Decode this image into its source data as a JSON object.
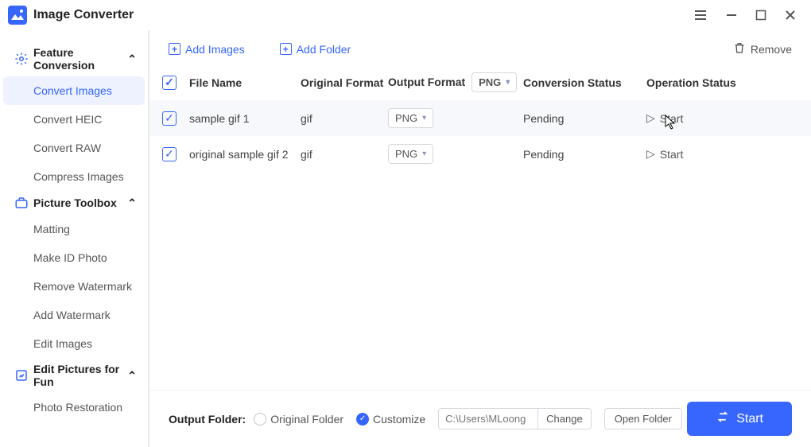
{
  "app": {
    "title": "Image Converter"
  },
  "sidebar": {
    "sections": [
      {
        "title": "Feature Conversion",
        "items": [
          "Convert Images",
          "Convert HEIC",
          "Convert RAW",
          "Compress Images"
        ],
        "active": 0
      },
      {
        "title": "Picture Toolbox",
        "items": [
          "Matting",
          "Make ID Photo",
          "Remove Watermark",
          "Add Watermark",
          "Edit Images"
        ]
      },
      {
        "title": "Edit Pictures for Fun",
        "items": [
          "Photo Restoration"
        ]
      }
    ]
  },
  "toolbar": {
    "add_images": "Add Images",
    "add_folder": "Add Folder",
    "remove": "Remove"
  },
  "table": {
    "headers": {
      "file_name": "File Name",
      "original": "Original Format",
      "output": "Output Format",
      "status": "Conversion Status",
      "operation": "Operation Status"
    },
    "header_output_value": "PNG",
    "rows": [
      {
        "name": "sample gif 1",
        "original": "gif",
        "output": "PNG",
        "status": "Pending",
        "operation": "Start"
      },
      {
        "name": "original sample gif 2",
        "original": "gif",
        "output": "PNG",
        "status": "Pending",
        "operation": "Start"
      }
    ]
  },
  "footer": {
    "label": "Output Folder:",
    "original": "Original Folder",
    "customize": "Customize",
    "path_placeholder": "C:\\Users\\MLoong",
    "change": "Change",
    "open": "Open Folder",
    "start": "Start"
  }
}
